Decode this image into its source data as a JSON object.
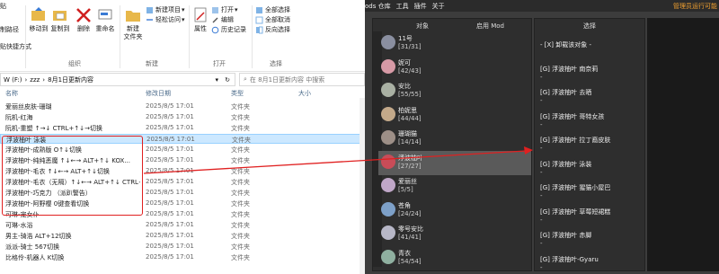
{
  "colors": {
    "accent_red": "#e02020",
    "selection": "#cce8ff",
    "mod_bg": "#3c3c3c",
    "admin_orange": "#f0a030"
  },
  "ribbon": {
    "pin_label": "贴",
    "copy_path": "制路径",
    "paste_shortcut": "贴快捷方式",
    "move_to": "移动到",
    "copy_to": "复制到",
    "delete": "删除",
    "rename": "重命名",
    "new_folder": "新建\n文件夹",
    "new_item": "新建项目",
    "easy_access": "轻松访问",
    "properties": "属性",
    "open": "打开",
    "edit": "编辑",
    "history": "历史记录",
    "select_all": "全部选择",
    "select_none": "全部取消",
    "invert_select": "反向选择",
    "group_organize": "组织",
    "group_new": "新建",
    "group_open": "打开",
    "group_select": "选择",
    "group_edit": "编辑"
  },
  "address": {
    "parts": [
      "W (F:)",
      "zzz",
      "8月1日更新内容"
    ],
    "search_placeholder": "在 8月1日更新内容 中搜索"
  },
  "columns": {
    "name": "名称",
    "date": "修改日期",
    "type": "类型",
    "size": "大小"
  },
  "files": [
    {
      "name": "爱丽丝皮肤-珊瑚",
      "date": "2025/8/5 17:01",
      "type": "文件夹"
    },
    {
      "name": "阮机-红海",
      "date": "2025/8/5 17:01",
      "type": "文件夹"
    },
    {
      "name": "阮机-重塑 ↑→↓ CTRL+↑↓→切换",
      "date": "2025/8/5 17:01",
      "type": "文件夹"
    },
    {
      "name": "浮波柚叶 泳装",
      "date": "2025/8/5 17:01",
      "type": "文件夹"
    },
    {
      "name": "浮波柚叶-成熟版 O↑↓切换",
      "date": "2025/8/5 17:01",
      "type": "文件夹"
    },
    {
      "name": "浮波柚叶-纯纯恶魔 ↑↓←→ ALT+↑↓ KOX...",
      "date": "2025/8/5 17:01",
      "type": "文件夹"
    },
    {
      "name": "浮波柚叶-毛衣 ↑↓←→ ALT+↑↓切换",
      "date": "2025/8/5 17:01",
      "type": "文件夹"
    },
    {
      "name": "浮波柚叶-毛衣（无隔）↑↓←→ ALT+↑↓ CTRL+...",
      "date": "2025/8/5 17:01",
      "type": "文件夹"
    },
    {
      "name": "浮波柚叶-巧克力 （派趴警告）",
      "date": "2025/8/5 17:01",
      "type": "文件夹"
    },
    {
      "name": "浮波柚叶-阿野樱 0键查看切换",
      "date": "2025/8/5 17:01",
      "type": "文件夹"
    },
    {
      "name": "可琳-宠女仆",
      "date": "2025/8/5 17:01",
      "type": "文件夹"
    },
    {
      "name": "可琳-水浴",
      "date": "2025/8/5 17:01",
      "type": "文件夹"
    },
    {
      "name": "男主-骑浩 ALT+12切换",
      "date": "2025/8/5 17:01",
      "type": "文件夹"
    },
    {
      "name": "派派-骑士 567切换",
      "date": "2025/8/5 17:01",
      "type": "文件夹"
    },
    {
      "name": "比格伶-机器人 K切换",
      "date": "2025/8/5 17:01",
      "type": "文件夹"
    }
  ],
  "mod": {
    "menu": [
      "ods 仓库",
      "工具",
      "插件",
      "关于"
    ],
    "admin": "管理员运行可能",
    "header_target": "对象",
    "header_enabled": "启用 Mod",
    "header_select": "选择",
    "characters": [
      {
        "name": "11号",
        "count": "[31/31]",
        "color": "#8a8fa0"
      },
      {
        "name": "妮可",
        "count": "[42/43]",
        "color": "#d79aa6"
      },
      {
        "name": "安比",
        "count": "[55/55]",
        "color": "#a9b0a3"
      },
      {
        "name": "柏妮思",
        "count": "[44/44]",
        "color": "#c3a98a"
      },
      {
        "name": "珊瑚猫",
        "count": "[14/14]",
        "color": "#9d8f87"
      },
      {
        "name": "浮波柚叶",
        "count": "[27/27]",
        "color": "#c84c58"
      },
      {
        "name": "爱丽丝",
        "count": "[5/5]",
        "color": "#c0a7c8"
      },
      {
        "name": "苍角",
        "count": "[24/24]",
        "color": "#7da0c8"
      },
      {
        "name": "零号安比",
        "count": "[41/41]",
        "color": "#b7b7c7"
      },
      {
        "name": "青衣",
        "count": "[54/54]",
        "color": "#8fb0a0"
      }
    ],
    "options": [
      "- [X] 卸载该对象 -",
      "[G] 浮波柚叶 南奈莉",
      "[G] 浮波柚叶 去晒",
      "[G] 浮波柚叶 哥特女孩",
      "[G] 浮波柚叶 拉丁裔皮肤",
      "[G] 浮波柚叶 泳装",
      "[G] 浮波柚叶 猩猫小屋巴",
      "[G] 浮波柚叶 草莓短裙糕",
      "[G] 浮波柚叶 赤脚",
      "[G] 浮波柚叶-Gyaru"
    ],
    "dash": "-"
  }
}
